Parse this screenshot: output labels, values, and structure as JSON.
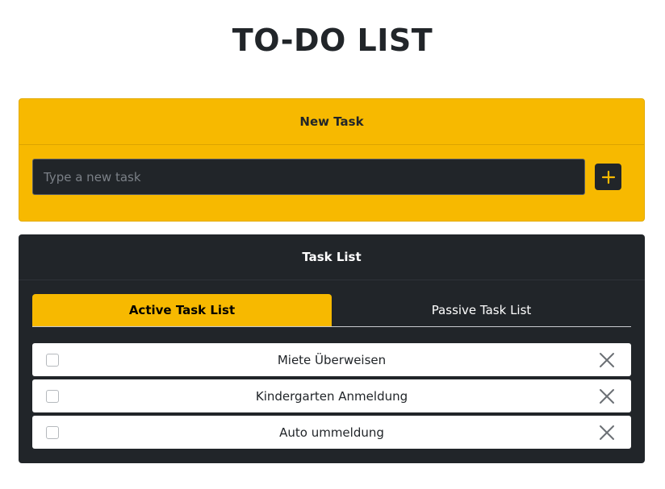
{
  "header": {
    "title": "TO-DO LIST"
  },
  "new_task": {
    "title": "New Task",
    "input_placeholder": "Type a new task",
    "input_value": "",
    "add_icon": "plus-icon"
  },
  "task_list": {
    "title": "Task List",
    "tabs": [
      {
        "label": "Active Task List",
        "active": true
      },
      {
        "label": "Passive Task List",
        "active": false
      }
    ],
    "items": [
      {
        "text": "Miete Überweisen",
        "checked": false
      },
      {
        "text": "Kindergarten Anmeldung",
        "checked": false
      },
      {
        "text": "Auto ummeldung",
        "checked": false
      }
    ],
    "delete_icon": "close-icon"
  },
  "colors": {
    "accent": "#f7b900",
    "dark": "#212529",
    "white": "#ffffff"
  }
}
